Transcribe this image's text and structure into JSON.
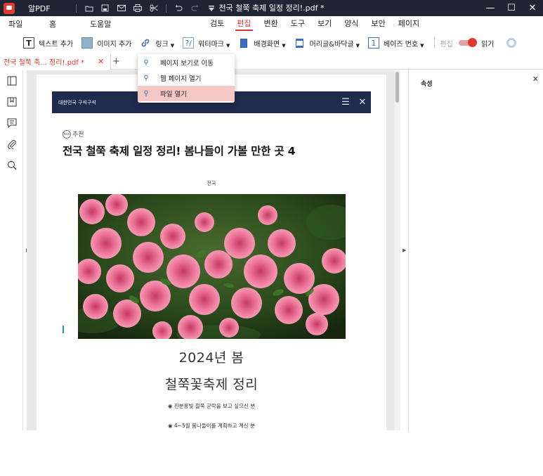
{
  "app": {
    "name": "알PDF",
    "document_title": "전국 철쭉 축제 일정 정리!.pdf *"
  },
  "titlebar_icons": [
    "folder-icon",
    "save-icon",
    "mail-icon",
    "print-icon",
    "scissors-icon",
    "undo-icon",
    "redo-icon",
    "dropdown-icon"
  ],
  "menu": {
    "left": [
      "파일",
      "홈",
      "도움말"
    ],
    "center": [
      "검토",
      "편집",
      "변환",
      "도구",
      "보기",
      "양식",
      "보안",
      "페이지"
    ],
    "active": "편집"
  },
  "toolbar": {
    "add_text": "텍스트 추가",
    "add_image": "이미지 추가",
    "link": "링크",
    "watermark": "워터마크",
    "background": "배경화면",
    "header_footer": "머리글&바닥글",
    "bates": "베이즈 번호",
    "edit_label": "편집",
    "read_label": "읽기",
    "accent_color": "#e2362c"
  },
  "tab": {
    "name": "전국 철쭉 축... 정리!.pdf *"
  },
  "link_menu": {
    "items": [
      {
        "label": "페이지 보기로 이동",
        "icon": "link-page-icon"
      },
      {
        "label": "웹 페이지 열기",
        "icon": "link-web-icon"
      },
      {
        "label": "파일 열기",
        "icon": "link-file-icon",
        "highlighted": true
      }
    ]
  },
  "right_panel": {
    "title": "속성"
  },
  "page": {
    "site_name": "대한민국 구석구석",
    "category": "추천",
    "category_badge": "New",
    "headline": "전국 철쭉 축제 일정 정리! 봄나들이 가볼 만한 곳 4",
    "region": "전국",
    "big_line1": "2024년 봄",
    "big_line2": "철쭉꽃축제 정리",
    "bullet1": "◉ 진분홍빛 철쭉 군락을 보고 싶으신 분",
    "bullet2": "◉ 4~5월 봄나들이를 계획하고 계신 분"
  }
}
